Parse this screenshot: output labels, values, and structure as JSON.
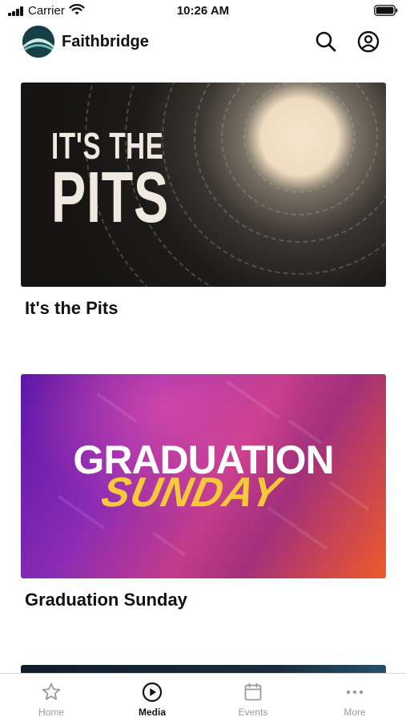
{
  "status_bar": {
    "carrier": "Carrier",
    "time": "10:26 AM"
  },
  "header": {
    "title": "Faithbridge",
    "search_icon": "search-icon",
    "account_icon": "user-circle-icon"
  },
  "media": {
    "items": [
      {
        "title": "It's the Pits",
        "artwork": {
          "line1": "IT'S THE",
          "line2": "PITS"
        }
      },
      {
        "title": "Graduation Sunday",
        "artwork": {
          "line1": "GRADUATION",
          "line2": "SUNDAY"
        }
      }
    ]
  },
  "tab_bar": {
    "tabs": [
      {
        "label": "Home",
        "icon": "star-icon",
        "active": false
      },
      {
        "label": "Media",
        "icon": "play-circle-icon",
        "active": true
      },
      {
        "label": "Events",
        "icon": "calendar-icon",
        "active": false
      },
      {
        "label": "More",
        "icon": "more-dots-icon",
        "active": false
      }
    ]
  },
  "colors": {
    "accent": "#111111",
    "inactive_tab": "#9a9a9a",
    "sunday_yellow": "#f6c83b"
  }
}
